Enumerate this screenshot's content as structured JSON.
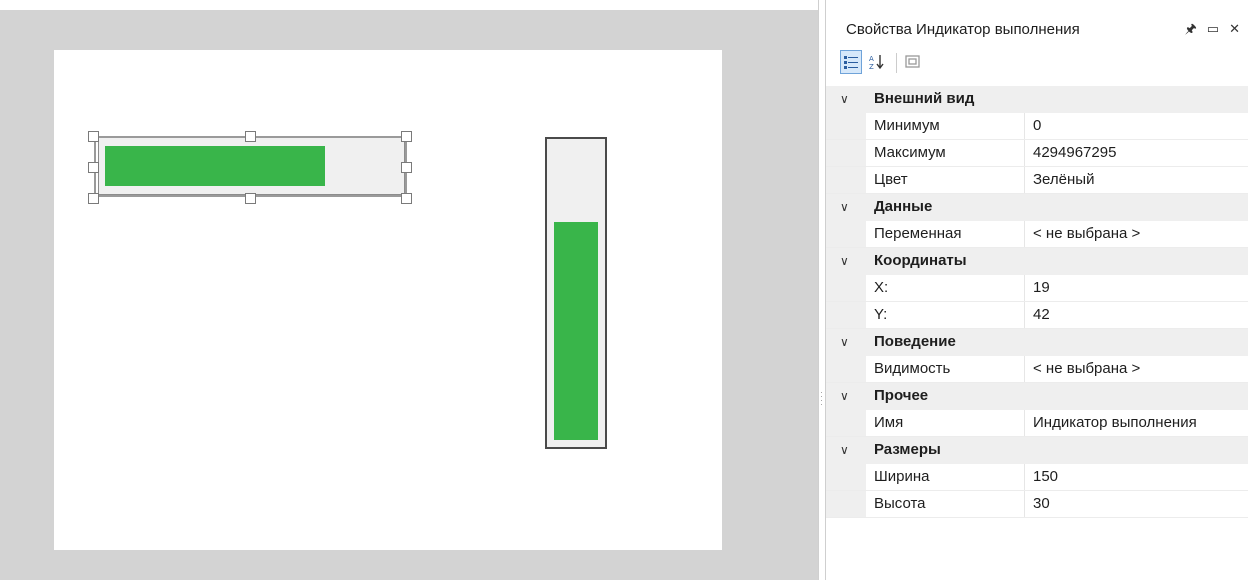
{
  "canvas": {
    "horizontal_progress": {
      "value": 0.75
    },
    "vertical_progress": {
      "value": 0.74
    }
  },
  "properties_panel": {
    "title": "Свойства Индикатор выполнения",
    "window_buttons": [
      "pin-icon",
      "maximize-icon",
      "close-icon"
    ],
    "toolbar": [
      "categorized-icon",
      "sort-alphabetical-icon",
      "property-pages-icon"
    ],
    "categories": [
      {
        "label": "Внешний вид",
        "props": [
          {
            "name": "Минимум",
            "value": "0"
          },
          {
            "name": "Максимум",
            "value": "4294967295"
          },
          {
            "name": "Цвет",
            "value": "Зелёный"
          }
        ]
      },
      {
        "label": "Данные",
        "props": [
          {
            "name": "Переменная",
            "value": "< не выбрана >"
          }
        ]
      },
      {
        "label": "Координаты",
        "props": [
          {
            "name": "X:",
            "value": "19"
          },
          {
            "name": "Y:",
            "value": "42"
          }
        ]
      },
      {
        "label": "Поведение",
        "props": [
          {
            "name": "Видимость",
            "value": "< не выбрана >"
          }
        ]
      },
      {
        "label": "Прочее",
        "props": [
          {
            "name": "Имя",
            "value": "Индикатор выполнения"
          }
        ]
      },
      {
        "label": "Размеры",
        "props": [
          {
            "name": "Ширина",
            "value": "150"
          },
          {
            "name": "Высота",
            "value": "30"
          }
        ]
      }
    ]
  },
  "colors": {
    "progress_fill": "#39b54a",
    "designer_bg": "#d3d3d3"
  }
}
